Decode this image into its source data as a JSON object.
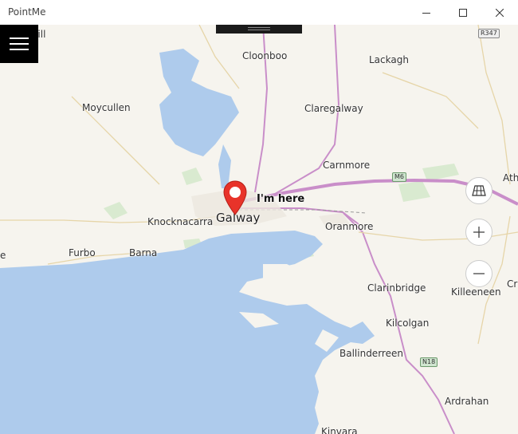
{
  "window": {
    "title": "PointMe"
  },
  "map": {
    "pin_label": "I'm here",
    "places": [
      {
        "key": "isscahill",
        "name": "isscahill"
      },
      {
        "key": "cloonboo",
        "name": "Cloonboo"
      },
      {
        "key": "lackagh",
        "name": "Lackagh"
      },
      {
        "key": "moycullen",
        "name": "Moycullen"
      },
      {
        "key": "claregalway",
        "name": "Claregalway"
      },
      {
        "key": "carnmore",
        "name": "Carnmore"
      },
      {
        "key": "athenry",
        "name": "Ath"
      },
      {
        "key": "knocknacarra",
        "name": "Knocknacarra"
      },
      {
        "key": "galway",
        "name": "Galway"
      },
      {
        "key": "oranmore",
        "name": "Oranmore"
      },
      {
        "key": "furbo",
        "name": "Furbo"
      },
      {
        "key": "barna",
        "name": "Barna"
      },
      {
        "key": "edge-left",
        "name": "e"
      },
      {
        "key": "clarinbridge",
        "name": "Clarinbridge"
      },
      {
        "key": "cr",
        "name": "Cr"
      },
      {
        "key": "killeeneen",
        "name": "Killeeneen"
      },
      {
        "key": "kilcolgan",
        "name": "Kilcolgan"
      },
      {
        "key": "ballinderreen",
        "name": "Ballinderreen"
      },
      {
        "key": "ardrahan",
        "name": "Ardrahan"
      },
      {
        "key": "kinvara",
        "name": "Kinvara"
      }
    ],
    "road_shields": {
      "r347": "R347",
      "m6": "M6",
      "n18": "N18"
    }
  },
  "icons": {
    "menu": "hamburger-icon",
    "layers": "map-style-icon",
    "zoom_in": "plus-icon",
    "zoom_out": "minus-icon",
    "location": "location-pin-icon"
  },
  "colors": {
    "land": "#f6f4ee",
    "water": "#aecbec",
    "motorway": "#c98ec9",
    "pin": "#e8332a"
  }
}
